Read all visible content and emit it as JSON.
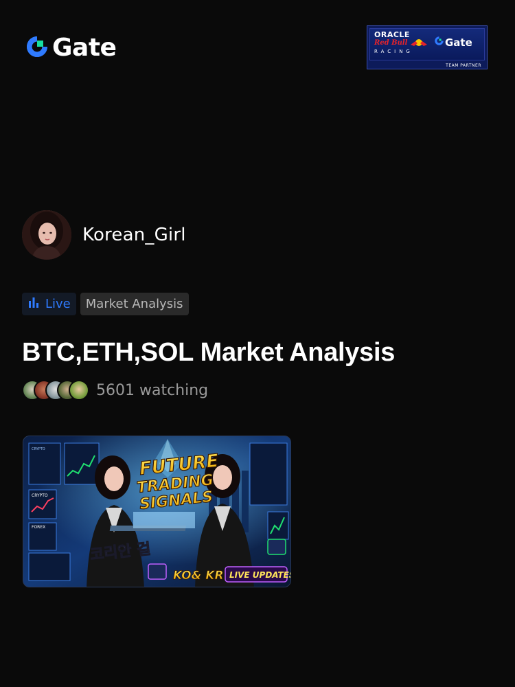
{
  "header": {
    "brand": "Gate",
    "partner_badge": {
      "line1": "ORACLE",
      "line2": "Red Bull",
      "line3": "RACING",
      "brand": "Gate",
      "caption": "TEAM PARTNER"
    }
  },
  "profile": {
    "username": "Korean_Girl"
  },
  "tags": {
    "live": "Live",
    "category": "Market Analysis"
  },
  "stream": {
    "title": "BTC,ETH,SOL Market Analysis",
    "watching_count": "5601",
    "watching_label": "5601 watching"
  },
  "thumbnail": {
    "headline_1": "FUTURE",
    "headline_2": "TRADING",
    "headline_3": "SIGNALS",
    "korean_text": "코리안 걸",
    "lang_label": "KO& KR",
    "badge": "LIVE UPDATES",
    "panel_1": "CRYPTO",
    "panel_2": "FOREX",
    "panel_3": "CRYPTO"
  },
  "colors": {
    "background": "#0a0a0a",
    "gate_blue": "#2f7bff",
    "gate_teal": "#17e0a0",
    "live_blue": "#2f7bff",
    "muted_text": "#9a9a9a"
  },
  "icons": {
    "brand": "gate-logo-icon",
    "live": "bar-chart-icon"
  }
}
